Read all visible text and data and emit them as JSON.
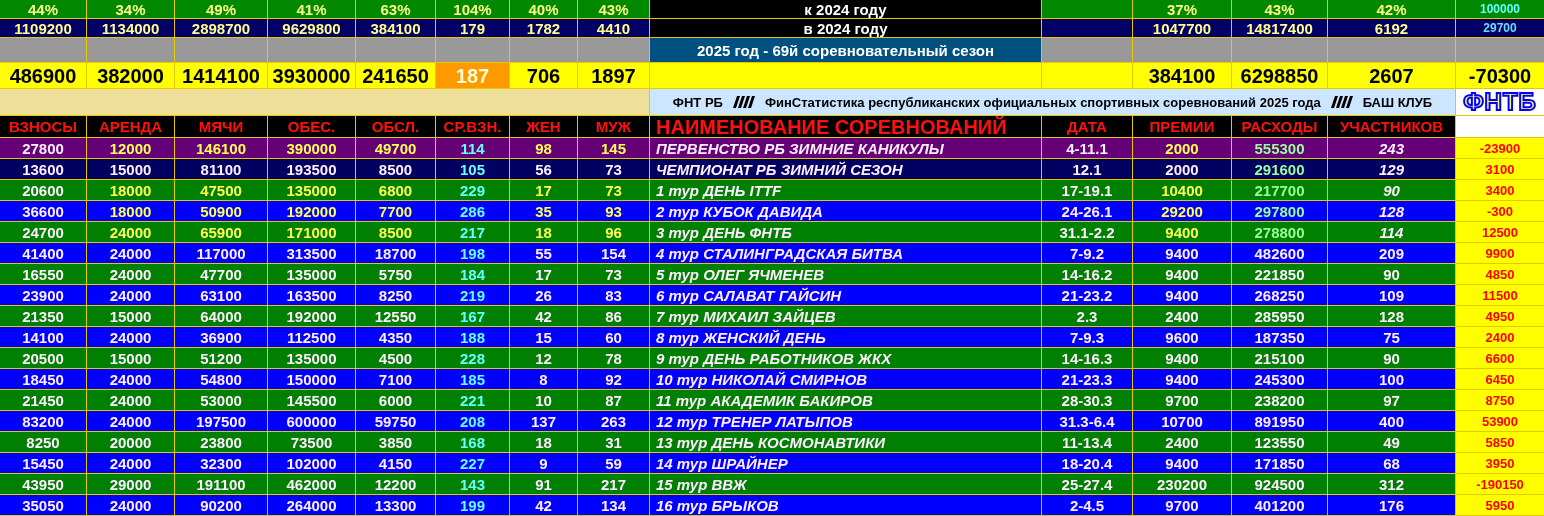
{
  "summary_rows": [
    {
      "kind": "percent",
      "cells": [
        "44%",
        "34%",
        "49%",
        "41%",
        "63%",
        "104%",
        "40%",
        "43%"
      ],
      "label": "к 2024 году",
      "totals": [
        "37%",
        "43%",
        "42%"
      ],
      "balance": "100000"
    },
    {
      "kind": "previous",
      "cells": [
        "1109200",
        "1134000",
        "2898700",
        "9629800",
        "384100",
        "179",
        "1782",
        "4410"
      ],
      "label": "в 2024 году",
      "totals": [
        "1047700",
        "14817400",
        "6192"
      ],
      "balance": "29700"
    },
    {
      "kind": "season",
      "label": "2025 год - 69й соревновательный сезон"
    },
    {
      "kind": "total",
      "cells": [
        {
          "text": "486900",
          "alert": false
        },
        {
          "text": "382000",
          "alert": false
        },
        {
          "text": "1414100",
          "alert": false
        },
        {
          "text": "3930000",
          "alert": false
        },
        {
          "text": "241650",
          "alert": false
        },
        {
          "text": "187",
          "alert": true
        },
        {
          "text": "706",
          "alert": false
        },
        {
          "text": "1897",
          "alert": false
        }
      ],
      "totals": [
        "384100",
        "6298850",
        "2607"
      ],
      "balance": "-70300"
    }
  ],
  "banner": {
    "parts": [
      "ФНТ РБ",
      "ФинСтатистика республиканских официальных спортивных соревнований 2025 года",
      "БАШ КЛУБ"
    ],
    "logo": "ФНТБ"
  },
  "columns": [
    "ВЗНОСЫ",
    "АРЕНДА",
    "МЯЧИ",
    "ОБЕС.",
    "ОБСЛ.",
    "СР.ВЗН.",
    "ЖЕН",
    "МУЖ",
    "НАИМЕНОВАНИЕ СОРЕВНОВАНИЙ",
    "ДАТА",
    "ПРЕМИИ",
    "РАСХОДЫ",
    "УЧАСТНИКОВ"
  ],
  "rows": [
    {
      "color": "#660077",
      "highlighted": true,
      "featured": true,
      "cells": [
        "27800",
        "12000",
        "146100",
        "390000",
        "49700",
        "114",
        "98",
        "145",
        "ПЕРВЕНСТВО РБ ЗИМНИЕ КАНИКУЛЫ",
        "4-11.1",
        "2000",
        "555300",
        "243",
        "-23900"
      ]
    },
    {
      "color": "#000060",
      "highlighted": false,
      "featured": true,
      "cells": [
        "13600",
        "15000",
        "81100",
        "193500",
        "8500",
        "105",
        "56",
        "73",
        "ЧЕМПИОНАТ РБ ЗИМНИЙ СЕЗОН",
        "12.1",
        "2000",
        "291600",
        "129",
        "3100"
      ]
    },
    {
      "color": "#008000",
      "highlighted": true,
      "featured": true,
      "cells": [
        "20600",
        "18000",
        "47500",
        "135000",
        "6800",
        "229",
        "17",
        "73",
        "1 тур ДЕНЬ ITTF",
        "17-19.1",
        "10400",
        "217700",
        "90",
        "3400"
      ]
    },
    {
      "color": "#0000ff",
      "highlighted": true,
      "featured": true,
      "cells": [
        "36600",
        "18000",
        "50900",
        "192000",
        "7700",
        "286",
        "35",
        "93",
        "2 тур КУБОК ДАВИДА",
        "24-26.1",
        "29200",
        "297800",
        "128",
        "-300"
      ]
    },
    {
      "color": "#008000",
      "highlighted": true,
      "featured": true,
      "cells": [
        "24700",
        "24000",
        "65900",
        "171000",
        "8500",
        "217",
        "18",
        "96",
        "3 тур ДЕНЬ ФНТБ",
        "31.1-2.2",
        "9400",
        "278800",
        "114",
        "12500"
      ]
    },
    {
      "color": "#0000ff",
      "highlighted": false,
      "featured": false,
      "cells": [
        "41400",
        "24000",
        "117000",
        "313500",
        "18700",
        "198",
        "55",
        "154",
        "4 тур СТАЛИНГРАДСКАЯ БИТВА",
        "7-9.2",
        "9400",
        "482600",
        "209",
        "9900"
      ]
    },
    {
      "color": "#008000",
      "highlighted": false,
      "featured": false,
      "cells": [
        "16550",
        "24000",
        "47700",
        "135000",
        "5750",
        "184",
        "17",
        "73",
        "5 тур ОЛЕГ ЯЧМЕНЕВ",
        "14-16.2",
        "9400",
        "221850",
        "90",
        "4850"
      ]
    },
    {
      "color": "#0000ff",
      "highlighted": false,
      "featured": false,
      "cells": [
        "23900",
        "24000",
        "63100",
        "163500",
        "8250",
        "219",
        "26",
        "83",
        "6 тур САЛАВАТ ГАЙСИН",
        "21-23.2",
        "9400",
        "268250",
        "109",
        "11500"
      ]
    },
    {
      "color": "#008000",
      "highlighted": false,
      "featured": false,
      "cells": [
        "21350",
        "15000",
        "64000",
        "192000",
        "12550",
        "167",
        "42",
        "86",
        "7 тур МИХАИЛ ЗАЙЦЕВ",
        "2.3",
        "2400",
        "285950",
        "128",
        "4950"
      ]
    },
    {
      "color": "#0000ff",
      "highlighted": false,
      "featured": false,
      "cells": [
        "14100",
        "24000",
        "36900",
        "112500",
        "4350",
        "188",
        "15",
        "60",
        "8 тур ЖЕНСКИЙ ДЕНЬ",
        "7-9.3",
        "9600",
        "187350",
        "75",
        "2400"
      ]
    },
    {
      "color": "#008000",
      "highlighted": false,
      "featured": false,
      "cells": [
        "20500",
        "15000",
        "51200",
        "135000",
        "4500",
        "228",
        "12",
        "78",
        "9 тур ДЕНЬ РАБОТНИКОВ ЖКХ",
        "14-16.3",
        "9400",
        "215100",
        "90",
        "6600"
      ]
    },
    {
      "color": "#0000ff",
      "highlighted": false,
      "featured": false,
      "cells": [
        "18450",
        "24000",
        "54800",
        "150000",
        "7100",
        "185",
        "8",
        "92",
        "10 тур НИКОЛАЙ СМИРНОВ",
        "21-23.3",
        "9400",
        "245300",
        "100",
        "6450"
      ]
    },
    {
      "color": "#008000",
      "highlighted": false,
      "featured": false,
      "cells": [
        "21450",
        "24000",
        "53000",
        "145500",
        "6000",
        "221",
        "10",
        "87",
        "11 тур АКАДЕМИК БАКИРОВ",
        "28-30.3",
        "9700",
        "238200",
        "97",
        "8750"
      ]
    },
    {
      "color": "#0000ff",
      "highlighted": false,
      "featured": false,
      "cells": [
        "83200",
        "24000",
        "197500",
        "600000",
        "59750",
        "208",
        "137",
        "263",
        "12 тур ТРЕНЕР ЛАТЫПОВ",
        "31.3-6.4",
        "10700",
        "891950",
        "400",
        "53900"
      ]
    },
    {
      "color": "#008000",
      "highlighted": false,
      "featured": false,
      "cells": [
        "8250",
        "20000",
        "23800",
        "73500",
        "3850",
        "168",
        "18",
        "31",
        "13 тур ДЕНЬ КОСМОНАВТИКИ",
        "11-13.4",
        "2400",
        "123550",
        "49",
        "5850"
      ]
    },
    {
      "color": "#0000ff",
      "highlighted": false,
      "featured": false,
      "cells": [
        "15450",
        "24000",
        "32300",
        "102000",
        "4150",
        "227",
        "9",
        "59",
        "14 тур ШРАЙНЕР",
        "18-20.4",
        "9400",
        "171850",
        "68",
        "3950"
      ]
    },
    {
      "color": "#008000",
      "highlighted": false,
      "featured": false,
      "cells": [
        "43950",
        "29000",
        "191100",
        "462000",
        "12200",
        "143",
        "91",
        "217",
        "15 тур ВВЖ",
        "25-27.4",
        "230200",
        "924500",
        "312",
        "-190150"
      ]
    },
    {
      "color": "#0000ff",
      "highlighted": false,
      "featured": false,
      "cells": [
        "35050",
        "24000",
        "90200",
        "264000",
        "13300",
        "199",
        "42",
        "134",
        "16 тур БРЫКОВ",
        "2-4.5",
        "9700",
        "401200",
        "176",
        "5950"
      ]
    }
  ]
}
